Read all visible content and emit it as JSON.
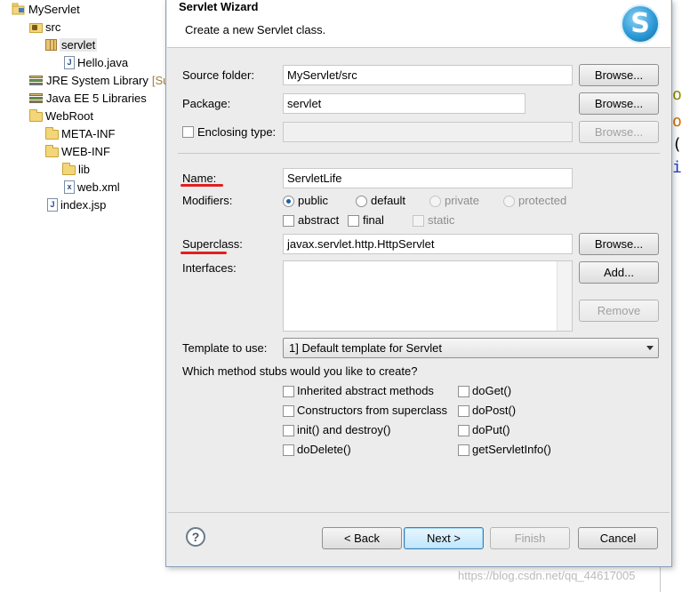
{
  "explorer": {
    "items": [
      {
        "label": "MyServlet",
        "icon": "project-icon"
      },
      {
        "label": "src",
        "icon": "source-folder-icon"
      },
      {
        "label": "servlet",
        "icon": "package-icon"
      },
      {
        "label": "Hello.java",
        "icon": "java-file-icon"
      },
      {
        "label": "JRE System Library",
        "note": "[Su",
        "icon": "library-icon"
      },
      {
        "label": "Java EE 5 Libraries",
        "icon": "library-icon"
      },
      {
        "label": "WebRoot",
        "icon": "folder-icon"
      },
      {
        "label": "META-INF",
        "icon": "folder-icon"
      },
      {
        "label": "WEB-INF",
        "icon": "folder-icon"
      },
      {
        "label": "lib",
        "icon": "folder-icon"
      },
      {
        "label": "web.xml",
        "icon": "xml-file-icon"
      },
      {
        "label": "index.jsp",
        "icon": "jsp-file-icon"
      }
    ]
  },
  "editor_chars": [
    "o",
    "o",
    "(",
    "i"
  ],
  "dialog": {
    "title": "Servlet Wizard",
    "subtitle": "Create a new Servlet class.",
    "logo_letter": "S",
    "source_folder": {
      "label": "Source folder:",
      "value": "MyServlet/src",
      "browse": "Browse..."
    },
    "package": {
      "label": "Package:",
      "value": "servlet",
      "browse": "Browse..."
    },
    "enclosing_type": {
      "label": "Enclosing type:",
      "value": "",
      "browse": "Browse..."
    },
    "name": {
      "label": "Name:",
      "value": "ServletLife"
    },
    "modifiers": {
      "label": "Modifiers:",
      "options": [
        "public",
        "default",
        "private",
        "protected"
      ],
      "selected": "public",
      "checks": [
        "abstract",
        "final",
        "static"
      ]
    },
    "superclass": {
      "label": "Superclass:",
      "value": "javax.servlet.http.HttpServlet",
      "browse": "Browse..."
    },
    "interfaces": {
      "label": "Interfaces:",
      "add": "Add...",
      "remove": "Remove"
    },
    "template": {
      "label": "Template to use:",
      "value": "1] Default template for Servlet"
    },
    "stubs": {
      "question": "Which method stubs would you like to create?",
      "left": [
        "Inherited abstract methods",
        "Constructors from superclass",
        "init() and destroy()",
        "doDelete()"
      ],
      "right": [
        "doGet()",
        "doPost()",
        "doPut()",
        "getServletInfo()"
      ]
    },
    "buttons": {
      "back": "< Back",
      "next": "Next >",
      "finish": "Finish",
      "cancel": "Cancel"
    },
    "help_glyph": "?"
  },
  "watermark": "https://blog.csdn.net/qq_44617005",
  "colors": {
    "accent_red": "#e02020",
    "dialog_bg": "#ececec",
    "selection": "#e8e8e8"
  }
}
